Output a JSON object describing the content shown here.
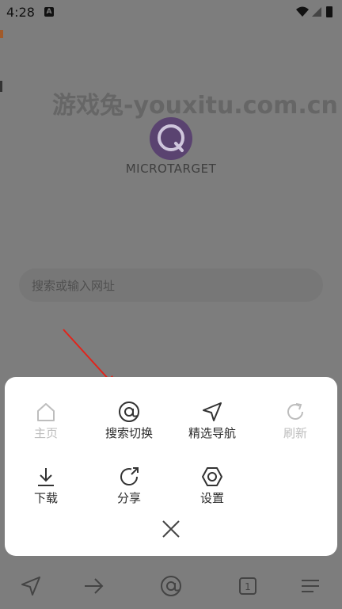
{
  "status": {
    "time": "4:28",
    "left_icon": "a-icon",
    "right_icons": [
      "wifi-icon",
      "signal-icon",
      "battery-icon"
    ]
  },
  "background": {
    "watermark": "游戏兔-youxitu.com.cn",
    "logo_text": "MICROTARGET",
    "logo_icon": "q-logo-icon",
    "search_placeholder": "搜索或输入网址"
  },
  "menu": {
    "items": [
      {
        "label": "主页",
        "icon": "home-icon",
        "disabled": true
      },
      {
        "label": "搜索切换",
        "icon": "at-icon",
        "disabled": false
      },
      {
        "label": "精选导航",
        "icon": "navigation-icon",
        "disabled": false
      },
      {
        "label": "刷新",
        "icon": "refresh-icon",
        "disabled": true
      },
      {
        "label": "下载",
        "icon": "download-icon",
        "disabled": false
      },
      {
        "label": "分享",
        "icon": "share-icon",
        "disabled": false
      },
      {
        "label": "设置",
        "icon": "settings-icon",
        "disabled": false
      }
    ],
    "close_icon": "close-icon"
  },
  "bottom_nav": {
    "tab_count": "1",
    "icons": [
      "navigation-icon",
      "forward-icon",
      "at-icon",
      "tabs-icon",
      "menu-icon"
    ]
  },
  "colors": {
    "overlay": "#7d7d7d",
    "panel": "#ffffff",
    "arrow": "#e2231a",
    "logo": "#5a4370"
  }
}
